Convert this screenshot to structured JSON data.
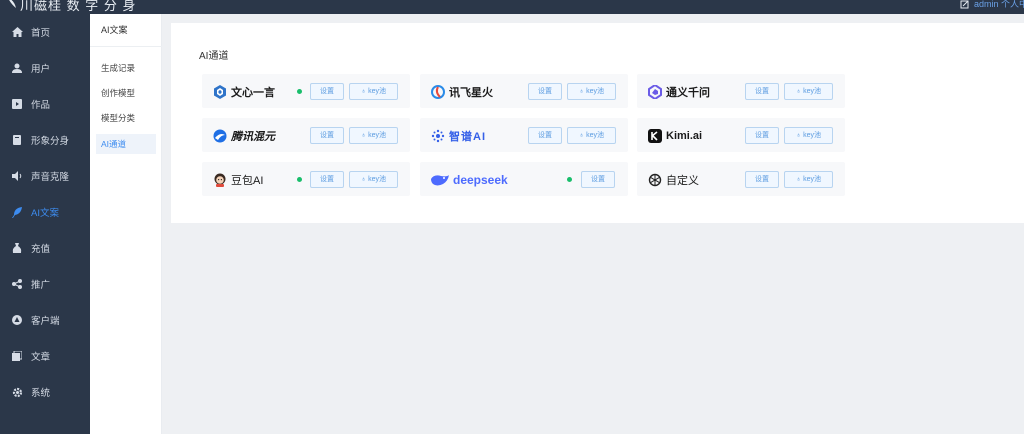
{
  "app": {
    "title": "川磁桂 数 字 分 身",
    "user": "admin 个人中"
  },
  "sidebar": {
    "items": [
      {
        "label": "首页",
        "icon": "home-icon"
      },
      {
        "label": "用户",
        "icon": "user-icon"
      },
      {
        "label": "作品",
        "icon": "works-icon"
      },
      {
        "label": "形象分身",
        "icon": "avatar-clone-icon"
      },
      {
        "label": "声音克隆",
        "icon": "voice-icon"
      },
      {
        "label": "AI文案",
        "icon": "feather-icon",
        "active": true
      },
      {
        "label": "充值",
        "icon": "wallet-icon"
      },
      {
        "label": "推广",
        "icon": "share-icon"
      },
      {
        "label": "客户端",
        "icon": "client-icon"
      },
      {
        "label": "文章",
        "icon": "article-icon"
      },
      {
        "label": "系统",
        "icon": "gear-icon"
      }
    ]
  },
  "subnav": {
    "title": "AI文案",
    "items": [
      {
        "label": "生成记录"
      },
      {
        "label": "创作模型"
      },
      {
        "label": "模型分类"
      },
      {
        "label": "AI通道",
        "active": true
      }
    ]
  },
  "main": {
    "title": "AI通道",
    "buttons": {
      "set": "设置",
      "key": "♁ key池"
    },
    "channels": [
      {
        "name": "文心一言",
        "icon": "wenxin-logo-icon",
        "active": true,
        "key_pool": true
      },
      {
        "name": "讯飞星火",
        "icon": "xunfei-logo-icon",
        "active": false,
        "key_pool": true
      },
      {
        "name": "通义千问",
        "icon": "tongyi-logo-icon",
        "active": false,
        "key_pool": true
      },
      {
        "name": "腾讯混元",
        "icon": "hunyuan-logo-icon",
        "active": false,
        "key_pool": true
      },
      {
        "name": "智谱AI",
        "icon": "zhipu-logo-icon",
        "active": false,
        "key_pool": true
      },
      {
        "name": "Kimi.ai",
        "icon": "kimi-logo-icon",
        "active": false,
        "key_pool": true
      },
      {
        "name": "豆包AI",
        "icon": "doubao-logo-icon",
        "active": true,
        "key_pool": true
      },
      {
        "name": "deepseek",
        "icon": "deepseek-logo-icon",
        "active": true,
        "key_pool": false
      },
      {
        "name": "自定义",
        "icon": "openai-logo-icon",
        "active": false,
        "key_pool": true
      }
    ]
  },
  "colors": {
    "sidebar_bg": "#2b3749",
    "accent": "#3d8cf0",
    "status_on": "#19be6b",
    "deepseek_blue": "#4d6bfe"
  }
}
